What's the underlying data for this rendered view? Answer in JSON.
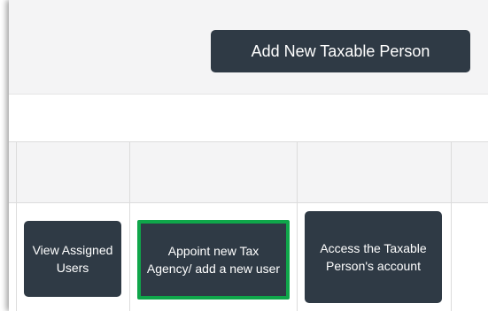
{
  "toolbar": {
    "add_button_label": "Add New Taxable Person"
  },
  "table": {
    "actions": {
      "view_assigned_users": "View Assigned Users",
      "appoint_tax_agency": "Appoint new Tax Agency/ add a new user",
      "access_account": "Access the Taxable Person's account"
    }
  },
  "colors": {
    "button_bg": "#2f3a45",
    "highlight_border": "#0fa64a",
    "header_bg": "#f4f4f5"
  }
}
